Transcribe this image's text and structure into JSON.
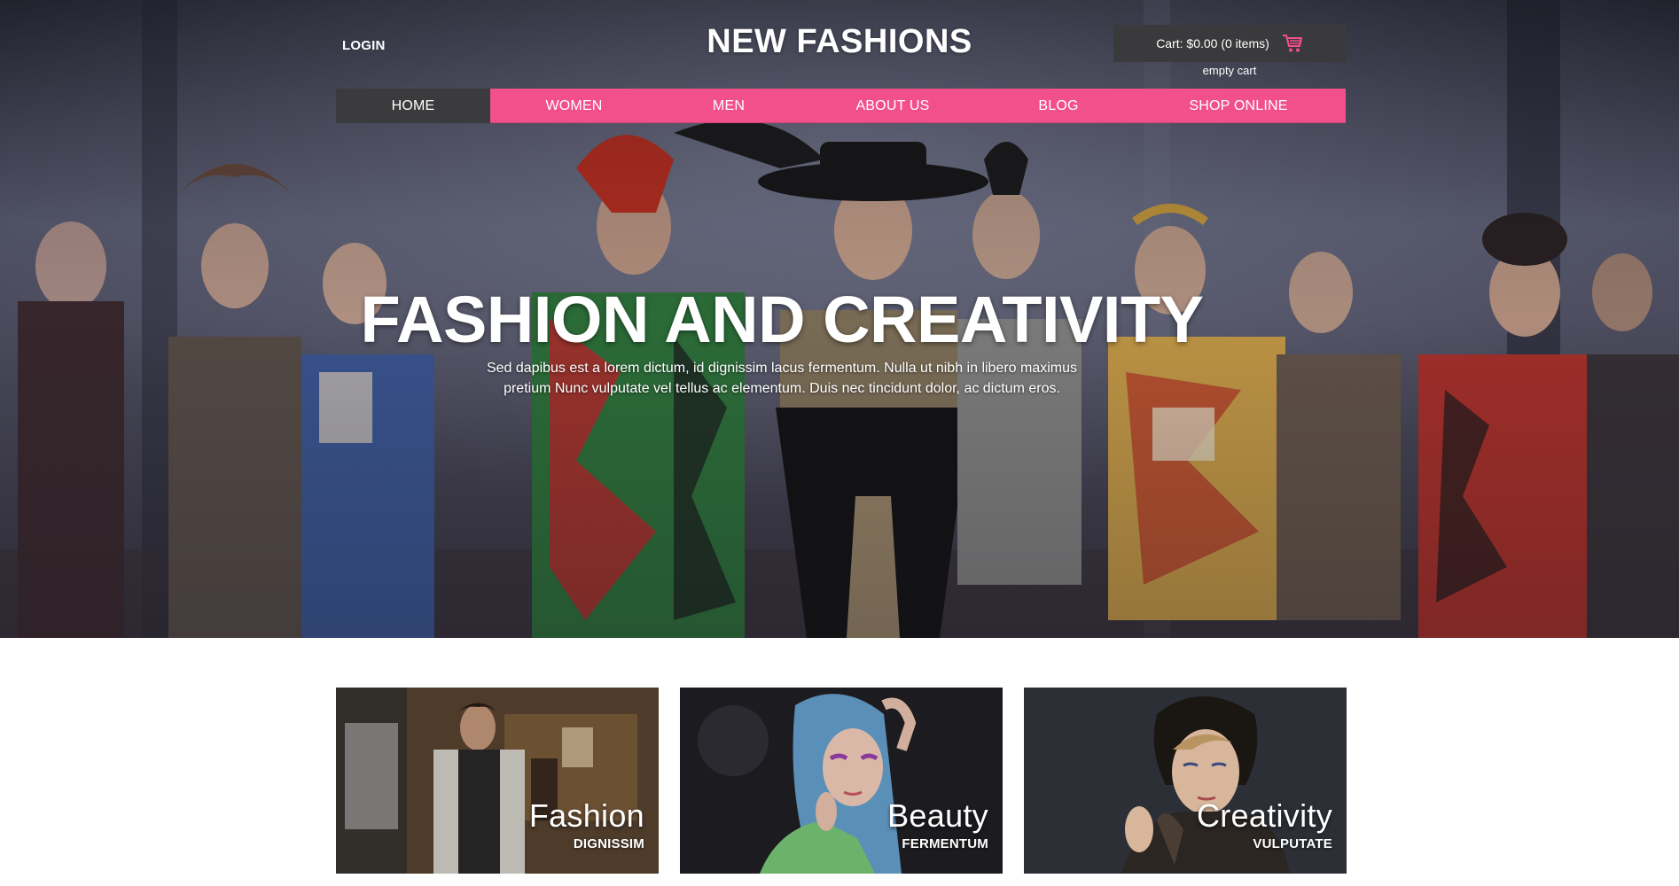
{
  "header": {
    "login_label": "LOGIN",
    "brand": "NEW FASHIONS",
    "cart_label": "Cart: $0.00 (0 items)",
    "empty_cart_label": "empty cart",
    "cart_icon": "shopping-cart-icon"
  },
  "nav": {
    "items": [
      {
        "label": "HOME",
        "active": true
      },
      {
        "label": "WOMEN",
        "active": false
      },
      {
        "label": "MEN",
        "active": false
      },
      {
        "label": "ABOUT US",
        "active": false
      },
      {
        "label": "BLOG",
        "active": false
      },
      {
        "label": "SHOP ONLINE",
        "active": false
      }
    ]
  },
  "hero": {
    "title": "FASHION AND CREATIVITY",
    "text_line1": "Sed dapibus est a lorem dictum, id dignissim lacus fermentum. Nulla ut nibh in libero maximus",
    "text_line2": "pretium Nunc vulputate vel tellus ac elementum. Duis nec tincidunt dolor, ac dictum eros."
  },
  "cards": [
    {
      "title": "Fashion",
      "subtitle": "DIGNISSIM"
    },
    {
      "title": "Beauty",
      "subtitle": "FERMENTUM"
    },
    {
      "title": "Creativity",
      "subtitle": "VULPUTATE"
    }
  ],
  "colors": {
    "accent_pink": "#f2508a",
    "nav_active": "#3b3b3d",
    "cart_bg": "#3a3a3c"
  }
}
